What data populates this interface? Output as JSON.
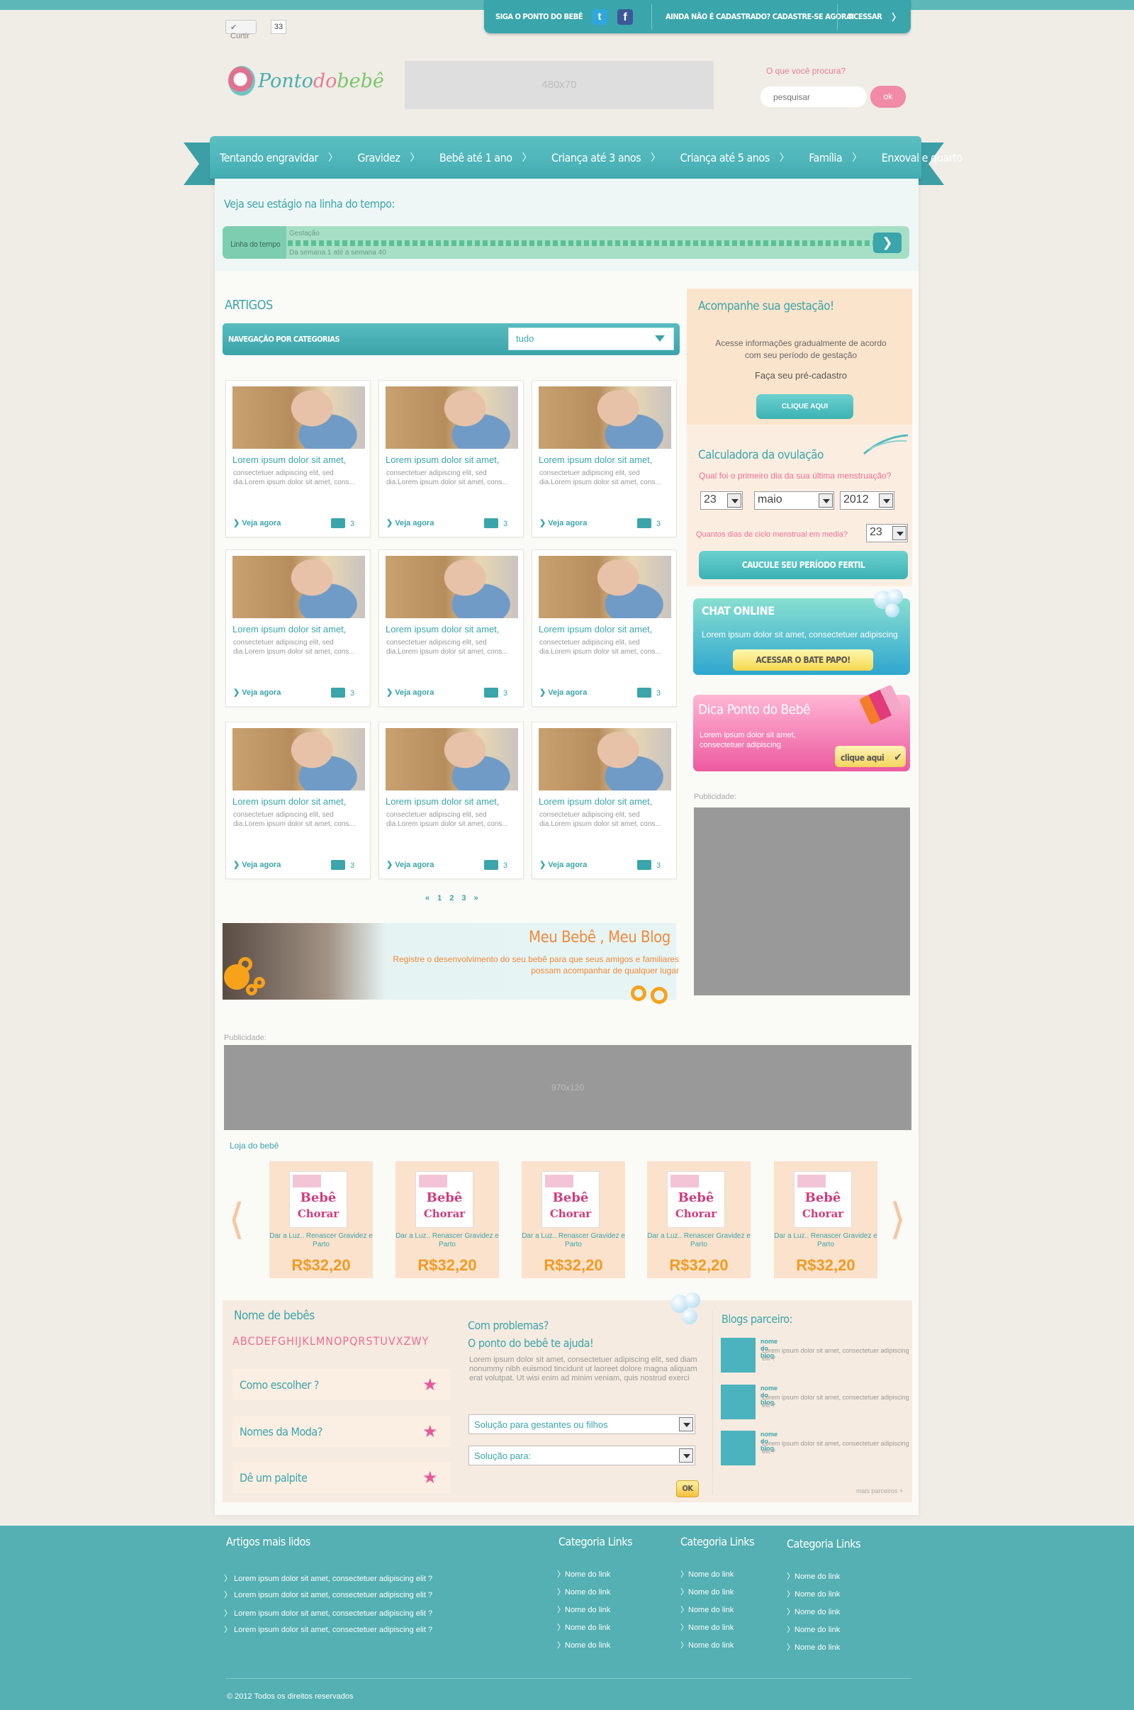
{
  "topbar": {
    "like_label": "✔ Curtir",
    "like_count": "33",
    "follow_label": "SIGA O  PONTO DO BEBÊ",
    "signup_label": "AINDA NÃO É CADASTRADO? CADASTRE-SE AGORA!",
    "login_label": "ACESSAR"
  },
  "header": {
    "logo_part1": "Ponto",
    "logo_part2": "do",
    "logo_part3": "bebê",
    "ad_label": "480x70",
    "search_label": "O que você procura?",
    "search_placeholder": "pesquisar",
    "search_button": "ok"
  },
  "nav": {
    "items": [
      {
        "label": "Tentando engravidar"
      },
      {
        "label": "Gravidez"
      },
      {
        "label": "Bebê até 1 ano"
      },
      {
        "label": "Criança até 3 anos"
      },
      {
        "label": "Criança até 5 anos"
      },
      {
        "label": "Família"
      },
      {
        "label": "Enxoval e quarto"
      }
    ]
  },
  "timeline": {
    "title": "Veja seu estágio na linha do tempo:",
    "label": "Linha do tempo",
    "stage": "Gestação",
    "range": "Da semana 1 até a semana 40"
  },
  "articles": {
    "title": "ARTIGOS",
    "category_label": "NAVEGAÇÃO POR CATEGORIAS",
    "category_selected": "tudo",
    "card_title": "Lorem ipsum dolor sit amet,",
    "card_desc": "consectetuer adipiscing elit, sed dia.Lorem ipsum dolor sit amet, cons...",
    "card_more": "Veja agora",
    "card_comments": "3",
    "pager": [
      "«",
      "1",
      "2",
      "3",
      "»"
    ]
  },
  "blog_banner": {
    "title": "Meu Bebê , Meu Blog",
    "text": "Registre o desenvolvimento do seu bebê para que seus amigos e familiares possam acompanhar de qualquer lugar"
  },
  "sidebar": {
    "acomp_title": "Acompanhe sua gestação!",
    "acomp_text": "Acesse informações gradualmente de acordo com seu período de gestação",
    "acomp_sub": "Faça seu pré-cadastro",
    "acomp_button": "CLIQUE AQUI",
    "ovul_title": "Calculadora da ovulação",
    "ovul_q1": "Qual foi o primeiro dia da sua última menstruação?",
    "ovul_day": "23",
    "ovul_month": "maio",
    "ovul_year": "2012",
    "ovul_q2": "Quantos dias  de ciclo menstrual em media?",
    "ovul_cycle": "23",
    "ovul_button": "CAUCULE SEU PERÍODO FERTIL",
    "chat_title": "CHAT ONLINE",
    "chat_text": "Lorem ipsum dolor sit amet, consectetuer adipiscing",
    "chat_button": "ACESSAR O BATE PAPO!",
    "dica_title": "Dica Ponto do Bebê",
    "dica_text": "Lorem ipsum dolor sit amet, consectetuer adipiscing",
    "dica_button": "clique aqui",
    "pub_label": "Publicidade:"
  },
  "ads": {
    "wide_label": "Publicidade:",
    "wide_size": "970x120"
  },
  "shop": {
    "title": "Loja do bebê",
    "products": [
      {
        "name": "Dar a Luz.. Renascer Gravidez e Parto",
        "price": "R$32,20"
      },
      {
        "name": "Dar a Luz.. Renascer Gravidez e Parto",
        "price": "R$32,20"
      },
      {
        "name": "Dar a Luz.. Renascer Gravidez e Parto",
        "price": "R$32,20"
      },
      {
        "name": "Dar a Luz.. Renascer Gravidez e Parto",
        "price": "R$32,20"
      },
      {
        "name": "Dar a Luz.. Renascer Gravidez e Parto",
        "price": "R$32,20"
      }
    ],
    "book_word1": "Bebê",
    "book_word2": "Chorar"
  },
  "names": {
    "title": "Nome de bebês",
    "alphabet": "ABCDEFGHIJKLMNOPQRSTUVXZWY",
    "items": [
      {
        "label": "Como escolher ?"
      },
      {
        "label": "Nomes da Moda?"
      },
      {
        "label": "Dê um palpite"
      }
    ]
  },
  "problems": {
    "title_line1": "Com problemas?",
    "title_line2": "O ponto do bebê te ajuda!",
    "text": "Lorem ipsum dolor sit amet, consectetuer adipiscing elit, sed diam nonummy nibh euismod tincidunt ut laoreet dolore magna aliquam erat volutpat. Ut wisi enim ad minim veniam, quis nostrud exerci",
    "select1": "Solução para gestantes ou filhos",
    "select2": "Solução para:",
    "ok": "OK"
  },
  "partners": {
    "title": "Blogs parceiro:",
    "items": [
      {
        "name": "nome do blog",
        "text": "Lorem ipsum dolor sit amet, consectetuer adipiscing elit ?"
      },
      {
        "name": "nome do blog",
        "text": "Lorem ipsum dolor sit amet, consectetuer adipiscing elit ?"
      },
      {
        "name": "nome do blog",
        "text": "Lorem ipsum dolor sit amet, consectetuer adipiscing elit ?"
      }
    ],
    "more": "mais parceiros +"
  },
  "footer": {
    "most_read_title": "Artigos mais lidos",
    "most_read": [
      "Lorem ipsum dolor sit amet, consectetuer adipiscing elit ?",
      "Lorem ipsum dolor sit amet, consectetuer adipiscing elit ?",
      "Lorem ipsum dolor sit amet, consectetuer adipiscing elit ?",
      "Lorem ipsum dolor sit amet, consectetuer adipiscing elit ?"
    ],
    "cat_title": "Categoria Links",
    "link_label": "Nome do link",
    "copyright": "©  2012 Todos os direitos reservados"
  }
}
